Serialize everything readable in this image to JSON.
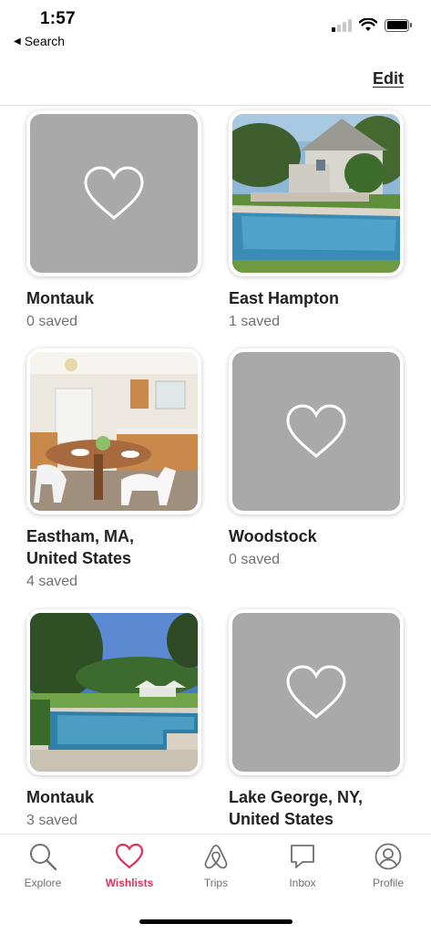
{
  "status_bar": {
    "time": "1:57",
    "back_label": "Search"
  },
  "header": {
    "edit_label": "Edit"
  },
  "wishlists": [
    {
      "title": "Montauk",
      "count": "0 saved",
      "image": "empty"
    },
    {
      "title": "East Hampton",
      "count": "1 saved",
      "image": "pool-house"
    },
    {
      "title": "Eastham, MA,\nUnited States",
      "count": "4 saved",
      "image": "kitchen"
    },
    {
      "title": "Woodstock",
      "count": "0 saved",
      "image": "empty"
    },
    {
      "title": "Montauk",
      "count": "3 saved",
      "image": "pool-garden"
    },
    {
      "title": "Lake George, NY,\nUnited States",
      "count": "",
      "image": "empty"
    }
  ],
  "tabs": [
    {
      "label": "Explore",
      "icon": "search-icon"
    },
    {
      "label": "Wishlists",
      "icon": "heart-icon",
      "active": true
    },
    {
      "label": "Trips",
      "icon": "airbnb-logo-icon"
    },
    {
      "label": "Inbox",
      "icon": "message-icon"
    },
    {
      "label": "Profile",
      "icon": "profile-icon"
    }
  ],
  "colors": {
    "accent": "#e0315b",
    "text": "#222222",
    "muted": "#717171",
    "placeholder": "#a9a9a9"
  }
}
